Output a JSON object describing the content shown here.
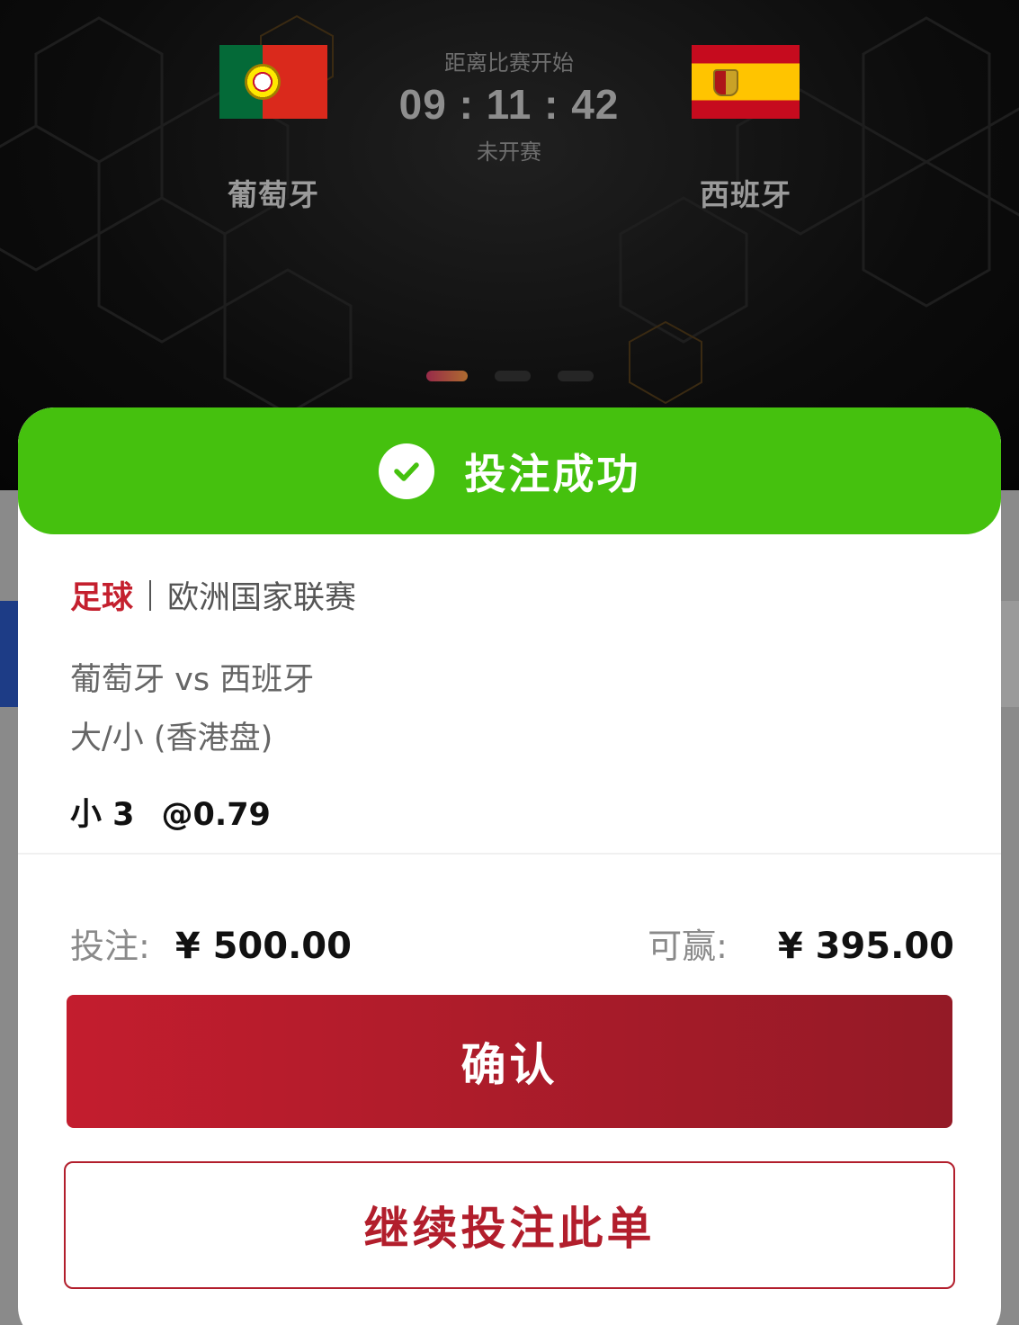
{
  "match_header": {
    "home_team": "葡萄牙",
    "away_team": "西班牙",
    "countdown_label": "距离比赛开始",
    "countdown_time": "09 : 11 : 42",
    "status": "未开赛",
    "home_flag_icon": "portugal-flag-icon",
    "away_flag_icon": "spain-flag-icon",
    "carousel_pages": 3,
    "carousel_active_index": 0
  },
  "modal": {
    "title": "投注成功",
    "title_icon": "check-circle-icon",
    "sport": "足球",
    "league": "欧洲国家联赛",
    "match": "葡萄牙 vs 西班牙",
    "market": "大/小 (香港盘)",
    "selection": "小 3",
    "odds": "@0.79",
    "stake_label": "投注:",
    "stake_value": "¥ 500.00",
    "win_label": "可赢:",
    "win_value": "¥ 395.00",
    "confirm_label": "确认",
    "continue_label": "继续投注此单"
  },
  "colors": {
    "success_green": "#45c10e",
    "accent_red": "#c4202e",
    "confirm_gradient_start": "#c31d2e",
    "confirm_gradient_end": "#941a26"
  }
}
